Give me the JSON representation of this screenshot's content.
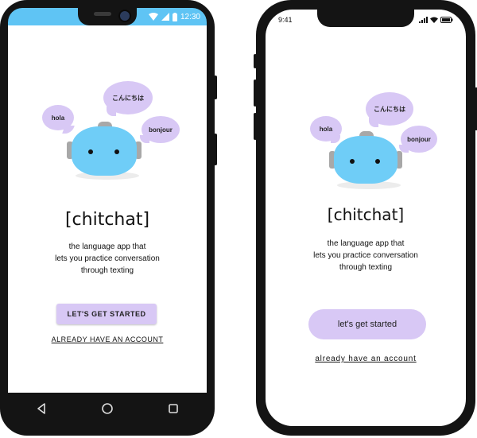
{
  "android": {
    "status_time": "12:30",
    "app": {
      "bubbles": {
        "left": "hola",
        "top": "こんにちは",
        "right": "bonjour"
      },
      "title": "[chitchat]",
      "tagline_lines": [
        "the language app that",
        "lets you practice conversation",
        "through texting"
      ],
      "primary_button": "LET'S GET STARTED",
      "secondary_link": "ALREADY HAVE AN ACCOUNT"
    }
  },
  "iphone": {
    "status_time": "9:41",
    "app": {
      "bubbles": {
        "left": "hola",
        "top": "こんにちは",
        "right": "bonjour"
      },
      "title": "[chitchat]",
      "tagline_lines": [
        "the language app that",
        "lets you practice conversation",
        "through texting"
      ],
      "primary_button": "let's get started",
      "secondary_link": "already have an account"
    }
  },
  "colors": {
    "accent_purple": "#d8c8f5",
    "robot_blue": "#6fcdf7",
    "android_status_bar": "#5fc4f4",
    "device_frame": "#141414"
  },
  "icons": [
    "wifi-icon",
    "signal-icon",
    "battery-icon",
    "back-icon",
    "home-icon",
    "recents-icon"
  ]
}
